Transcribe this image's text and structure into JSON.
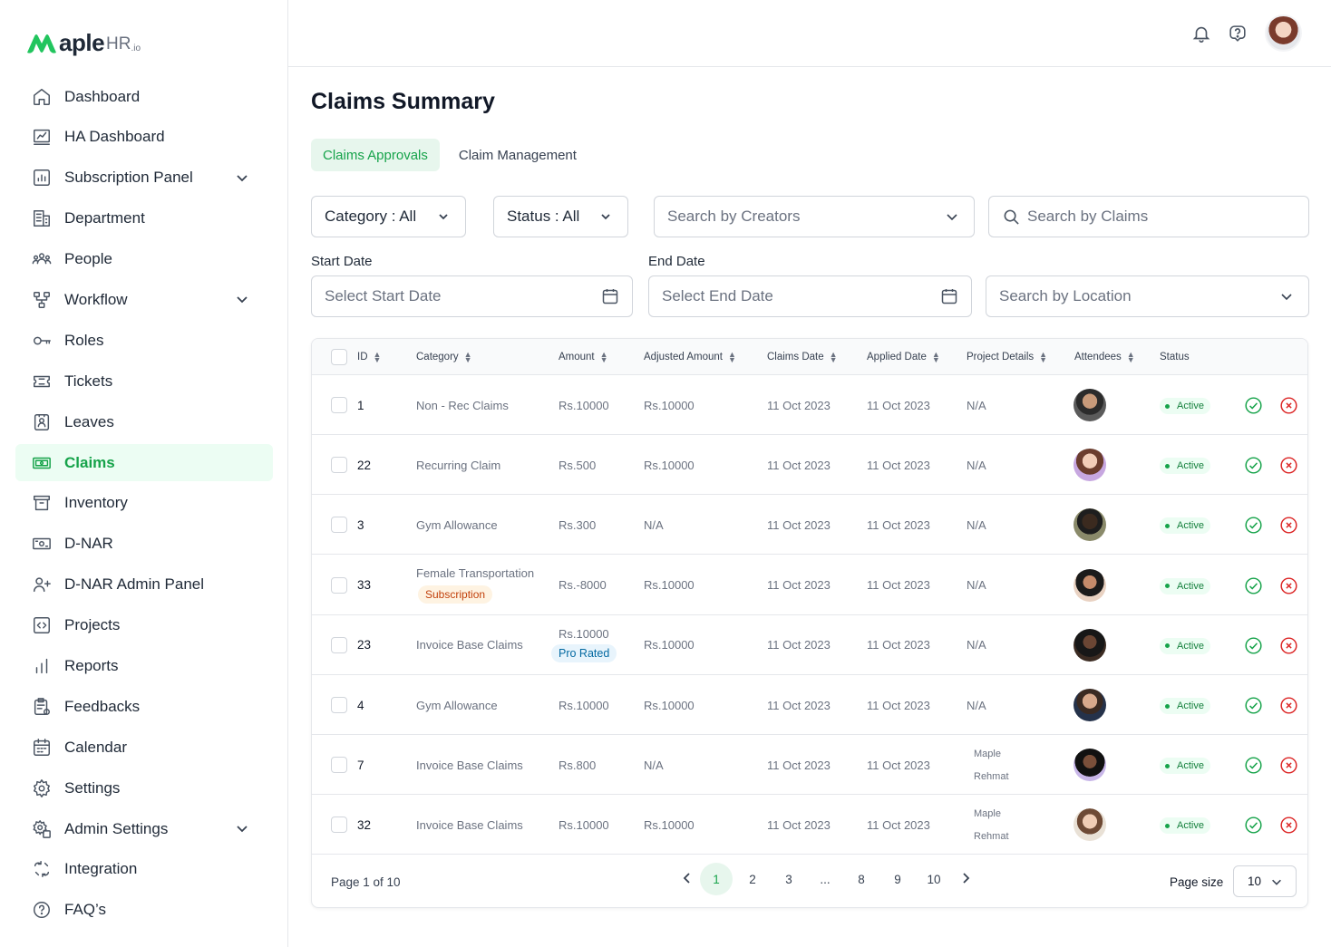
{
  "brand": {
    "name": "aple",
    "suffix": "HR",
    "tld": ".io",
    "color": "#22c55e"
  },
  "sidebar": {
    "items": [
      {
        "label": "Dashboard",
        "icon": "home-icon",
        "expandable": false
      },
      {
        "label": "HA Dashboard",
        "icon": "chart-board-icon",
        "expandable": false
      },
      {
        "label": "Subscription Panel",
        "icon": "subscription-icon",
        "expandable": true
      },
      {
        "label": "Department",
        "icon": "building-icon",
        "expandable": false
      },
      {
        "label": "People",
        "icon": "people-icon",
        "expandable": false
      },
      {
        "label": "Workflow",
        "icon": "workflow-icon",
        "expandable": true
      },
      {
        "label": "Roles",
        "icon": "key-icon",
        "expandable": false
      },
      {
        "label": "Tickets",
        "icon": "ticket-icon",
        "expandable": false
      },
      {
        "label": "Leaves",
        "icon": "leave-icon",
        "expandable": false
      },
      {
        "label": "Claims",
        "icon": "money-icon",
        "expandable": false,
        "active": true
      },
      {
        "label": "Inventory",
        "icon": "archive-icon",
        "expandable": false
      },
      {
        "label": "D-NAR",
        "icon": "dnar-icon",
        "expandable": false
      },
      {
        "label": "D-NAR Admin Panel",
        "icon": "user-plus-icon",
        "expandable": false
      },
      {
        "label": "Projects",
        "icon": "code-icon",
        "expandable": false
      },
      {
        "label": "Reports",
        "icon": "bar-chart-icon",
        "expandable": false
      },
      {
        "label": "Feedbacks",
        "icon": "clipboard-icon",
        "expandable": false
      },
      {
        "label": "Calendar",
        "icon": "calendar-icon",
        "expandable": false
      },
      {
        "label": "Settings",
        "icon": "gear-icon",
        "expandable": false
      },
      {
        "label": "Admin Settings",
        "icon": "admin-gear-icon",
        "expandable": true
      },
      {
        "label": "Integration",
        "icon": "integration-icon",
        "expandable": false
      },
      {
        "label": "FAQ’s",
        "icon": "help-icon",
        "expandable": false
      }
    ]
  },
  "page": {
    "title": "Claims Summary"
  },
  "tabs": [
    {
      "label": "Claims Approvals",
      "active": true
    },
    {
      "label": "Claim Management",
      "active": false
    }
  ],
  "filters": {
    "category": "Category : All",
    "status": "Status : All",
    "creators_placeholder": "Search by Creators",
    "claims_placeholder": "Search by Claims",
    "start_label": "Start Date",
    "start_placeholder": "Select Start Date",
    "end_label": "End Date",
    "end_placeholder": "Select End Date",
    "location_placeholder": "Search by Location"
  },
  "table": {
    "headers": [
      "ID",
      "Category",
      "Amount",
      "Adjusted Amount",
      "Claims Date",
      "Applied Date",
      "Project Details",
      "Attendees",
      "Status"
    ],
    "rows": [
      {
        "id": "1",
        "category": "Non - Rec Claims",
        "amount": "Rs.10000",
        "adjusted": "Rs.10000",
        "claims_date": "11 Oct 2023",
        "applied_date": "11 Oct 2023",
        "project": "N/A",
        "status": "Active"
      },
      {
        "id": "22",
        "category": "Recurring Claim",
        "amount": "Rs.500",
        "adjusted": "Rs.10000",
        "claims_date": "11 Oct 2023",
        "applied_date": "11 Oct 2023",
        "project": "N/A",
        "status": "Active"
      },
      {
        "id": "3",
        "category": "Gym Allowance",
        "amount": "Rs.300",
        "adjusted": "N/A",
        "claims_date": "11 Oct 2023",
        "applied_date": "11 Oct 2023",
        "project": "N/A",
        "status": "Active"
      },
      {
        "id": "33",
        "category": "Female Transportation",
        "category_tag": "Subscription",
        "amount": "Rs.-8000",
        "adjusted": "Rs.10000",
        "claims_date": "11 Oct 2023",
        "applied_date": "11 Oct 2023",
        "project": "N/A",
        "status": "Active"
      },
      {
        "id": "23",
        "category": "Invoice Base Claims",
        "amount": "Rs.10000",
        "amount_tag": "Pro Rated",
        "adjusted": "Rs.10000",
        "claims_date": "11 Oct 2023",
        "applied_date": "11 Oct 2023",
        "project": "N/A",
        "status": "Active"
      },
      {
        "id": "4",
        "category": "Gym Allowance",
        "amount": "Rs.10000",
        "adjusted": "Rs.10000",
        "claims_date": "11 Oct 2023",
        "applied_date": "11 Oct 2023",
        "project": "N/A",
        "status": "Active"
      },
      {
        "id": "7",
        "category": "Invoice Base Claims",
        "amount": "Rs.800",
        "adjusted": "N/A",
        "claims_date": "11 Oct 2023",
        "applied_date": "11 Oct 2023",
        "project_tags": [
          "Maple",
          "Rehmat"
        ],
        "status": "Active"
      },
      {
        "id": "32",
        "category": "Invoice Base Claims",
        "amount": "Rs.10000",
        "adjusted": "Rs.10000",
        "claims_date": "11 Oct 2023",
        "applied_date": "11 Oct 2023",
        "project_tags": [
          "Maple",
          "Rehmat"
        ],
        "status": "Active"
      }
    ]
  },
  "pagination": {
    "info": "Page 1 of 10",
    "pages": [
      "1",
      "2",
      "3",
      "...",
      "8",
      "9",
      "10"
    ],
    "current": "1",
    "size_label": "Page size",
    "size": "10"
  },
  "colors": {
    "accent": "#16a34a",
    "accent_bg": "#ecfdf3",
    "approve": "#16a34a",
    "reject": "#dc2626"
  }
}
